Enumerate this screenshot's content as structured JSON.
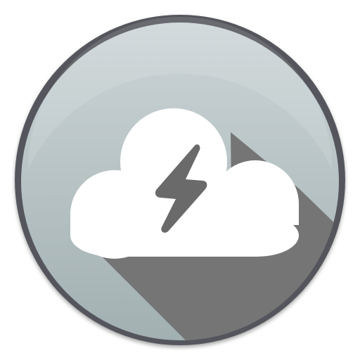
{
  "app_icon": {
    "icon": "thunderstorm-cloud-icon",
    "glyph": "lightning-bolt-icon",
    "colors": {
      "rim": "#54575d",
      "badge_top": "#ccd5d7",
      "badge_bottom": "#a2b0b1",
      "long_shadow": "#757575",
      "cloud": "#ffffff",
      "bolt": "#6a6a6a"
    }
  }
}
